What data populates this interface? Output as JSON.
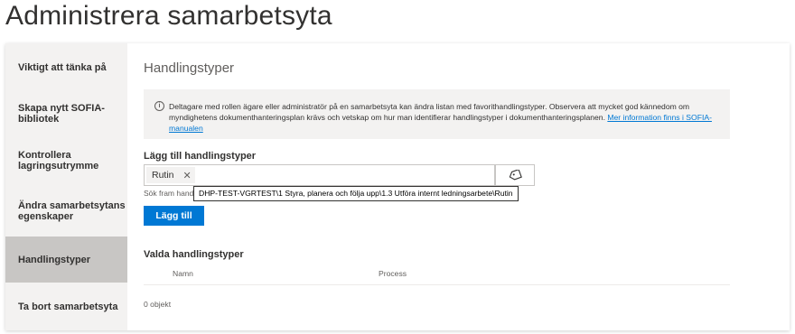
{
  "page": {
    "title": "Administrera samarbetsyta"
  },
  "sidebar": {
    "items": [
      {
        "label": "Viktigt att tänka på",
        "active": false
      },
      {
        "label": "Skapa nytt SOFIA-bibliotek",
        "active": false
      },
      {
        "label": "Kontrollera lagringsutrymme",
        "active": false
      },
      {
        "label": "Ändra samarbetsytans egenskaper",
        "active": false
      },
      {
        "label": "Handlingstyper",
        "active": true
      },
      {
        "label": "Ta bort samarbetsyta",
        "active": false
      }
    ]
  },
  "main": {
    "title": "Handlingstyper",
    "info": {
      "icon": "info-icon",
      "text": "Deltagare med rollen ägare eller administratör på en samarbetsyta kan ändra listan med favorithandlingstyper. Observera att mycket god kännedom om myndighetens dokumenthanteringsplan krävs och vetskap om hur man identifierar handlingstyper i dokumenthanteringsplanen. ",
      "link": "Mer information finns i SOFIA-manualen"
    },
    "add_label": "Lägg till handlingstyper",
    "picker": {
      "tag": "Rutin",
      "close_glyph": "✕",
      "browse_icon": "tag-icon"
    },
    "helper": "Sök fram hand",
    "tooltip": "DHP-TEST-VGRTEST\\1 Styra, planera och följa upp\\1.3 Utföra internt ledningsarbete\\Rutin",
    "add_button": "Lägg till",
    "selected_title": "Valda handlingstyper",
    "table": {
      "columns": [
        "Namn",
        "Process"
      ]
    },
    "count": "0 objekt"
  },
  "colors": {
    "accent": "#0078d4",
    "sidebar_bg": "#f3f2f1",
    "sidebar_active": "#c8c6c4"
  }
}
